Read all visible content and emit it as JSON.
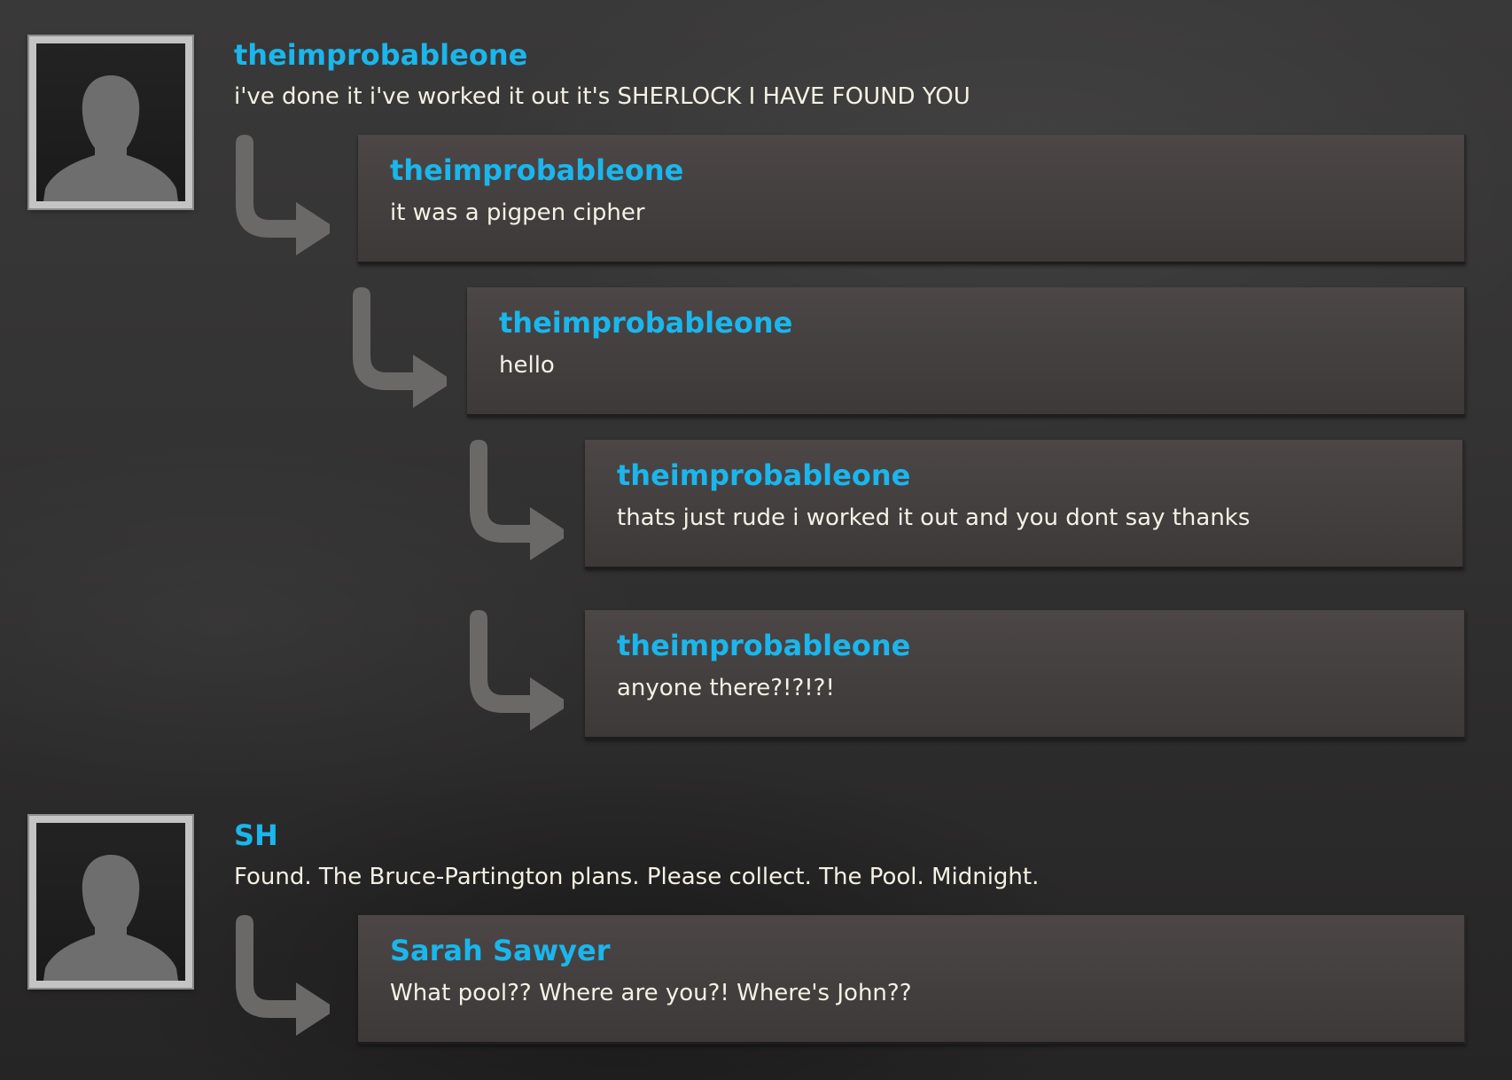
{
  "posts": [
    {
      "author": "theimprobableone",
      "text": "i've done it i've worked it out it's SHERLOCK I HAVE FOUND YOU",
      "replies": [
        {
          "author": "theimprobableone",
          "text": "it was a pigpen cipher"
        },
        {
          "author": "theimprobableone",
          "text": "hello"
        },
        {
          "author": "theimprobableone",
          "text": "thats just rude i worked it out and you dont say thanks"
        },
        {
          "author": "theimprobableone",
          "text": "anyone there?!?!?!"
        }
      ]
    },
    {
      "author": "SH",
      "text": "Found. The Bruce-Partington plans. Please collect. The Pool. Midnight.",
      "replies": [
        {
          "author": "Sarah Sawyer",
          "text": "What pool?? Where are you?! Where's John??"
        }
      ]
    }
  ],
  "colors": {
    "author": "#1ab6ec",
    "text": "#f4f1e4",
    "reply_box": "#4a4444",
    "background": "#333232"
  },
  "icons": {
    "avatar": "default-user-silhouette-icon",
    "reply": "reply-arrow-icon"
  }
}
